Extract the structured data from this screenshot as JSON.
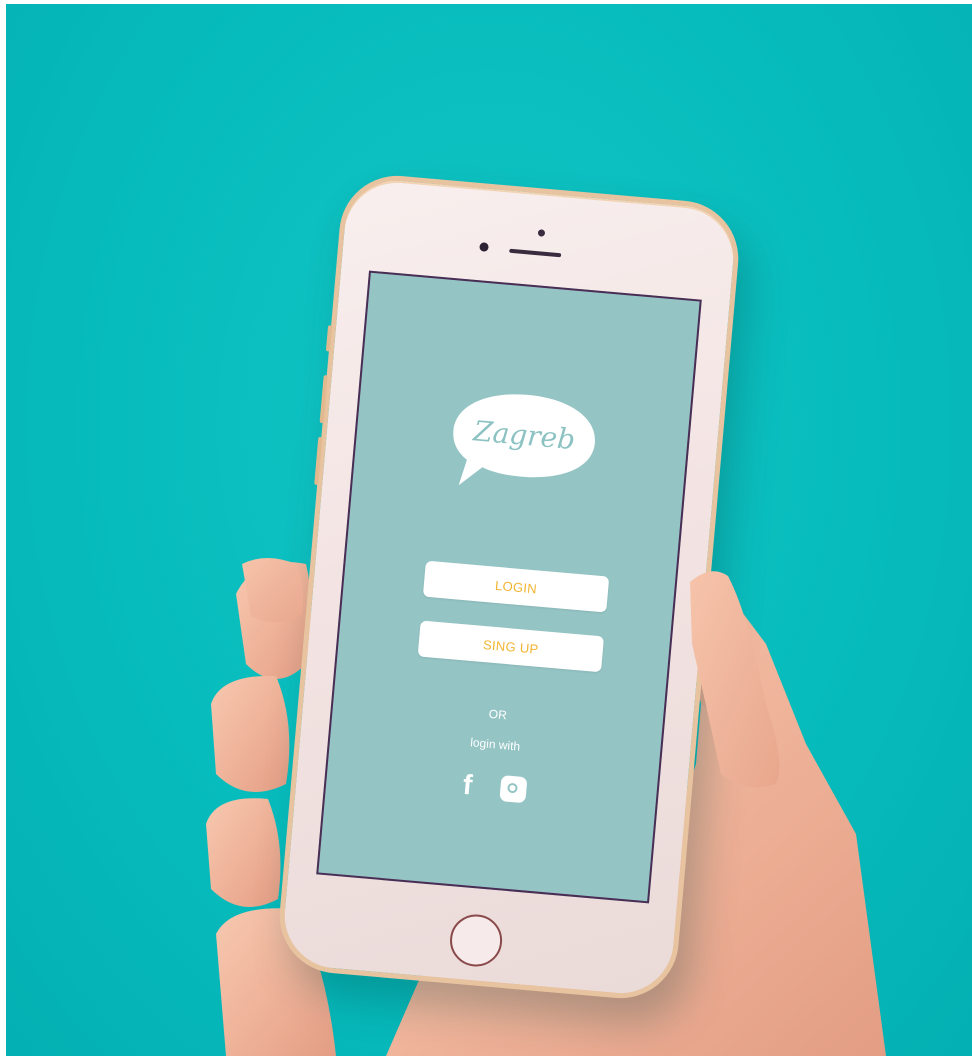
{
  "app": {
    "logo_text": "Zagreb",
    "login_label": "LOGIN",
    "signup_label": "SING UP",
    "or_text": "OR",
    "login_with_text": "login with",
    "social": [
      {
        "name": "facebook",
        "icon": "facebook-icon",
        "glyph": "f"
      },
      {
        "name": "instagram",
        "icon": "instagram-icon"
      }
    ]
  },
  "colors": {
    "background": "#07bcbd",
    "screen": "#95c4c4",
    "button": "#ffffff",
    "button_text": "#f2b533",
    "phone_body": "#f3e4e3",
    "phone_rim": "#e7c39f"
  }
}
